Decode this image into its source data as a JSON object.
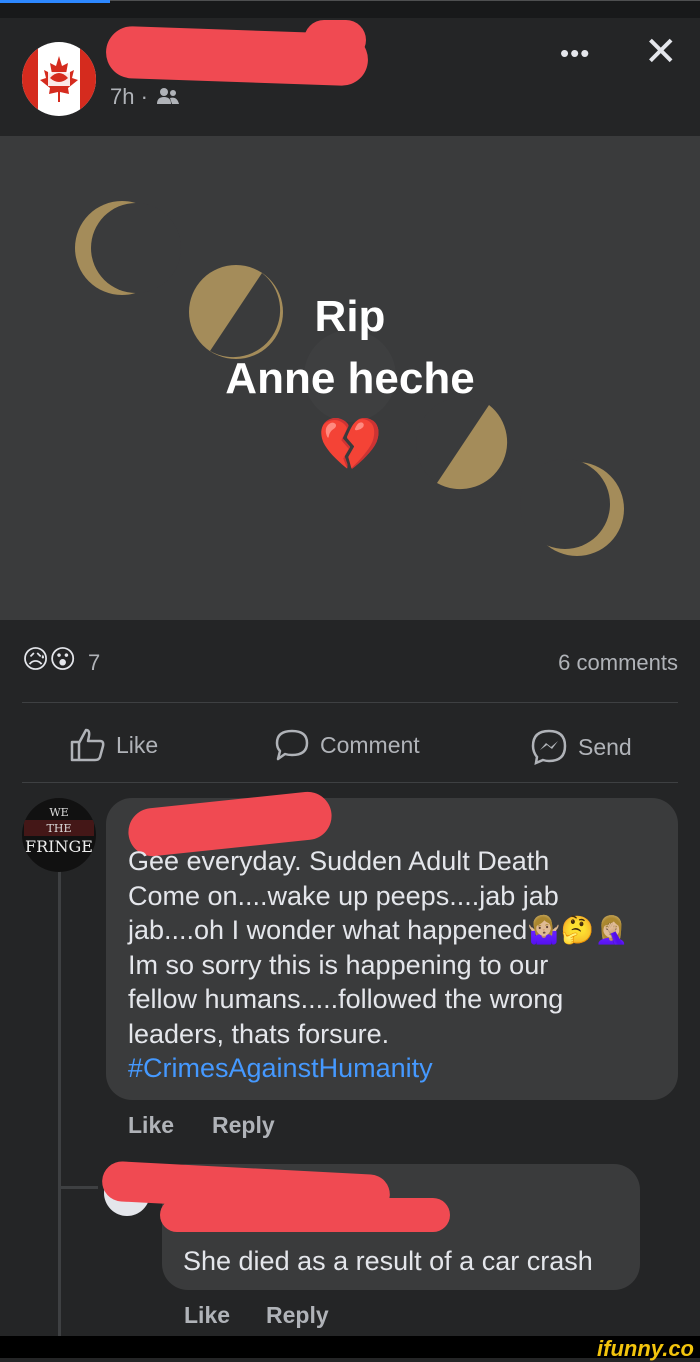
{
  "post": {
    "time": "7h ·",
    "privacy_icon": "friends-icon",
    "more_icon": "more-dots-icon",
    "close_icon": "close-icon",
    "more_glyph": "•••",
    "close_glyph": "✕",
    "title_line1": "Rip",
    "title_line2": "Anne heche",
    "title_emoji": "💔",
    "reaction_emojis": "😥😮",
    "reaction_count": "7",
    "comments_count": "6 comments"
  },
  "actions": {
    "like": "Like",
    "comment": "Comment",
    "send": "Send"
  },
  "comments": [
    {
      "avatar_text": "WE THE FRINGE",
      "lines": [
        "Gee everyday. Sudden Adult Death",
        "Come on....wake up peeps....jab jab",
        "jab....oh I wonder what happened🤷🏼‍♀️🤔🤦🏼‍♀️",
        "Im so sorry this is happening to our",
        "fellow humans.....followed the wrong",
        "leaders, thats forsure."
      ],
      "hashtag": "#CrimesAgainstHumanity",
      "like": "Like",
      "reply": "Reply"
    },
    {
      "text": "She died as a result of a car crash",
      "like": "Like",
      "reply": "Reply"
    }
  ],
  "watermark": "ifunny.co",
  "colors": {
    "background": "#242526",
    "post_background": "#3a3b3c",
    "redaction": "#f04a52",
    "moon_gold": "#a48c5a",
    "moon_dark": "#3a3b3c",
    "hashtag": "#4599ff"
  }
}
